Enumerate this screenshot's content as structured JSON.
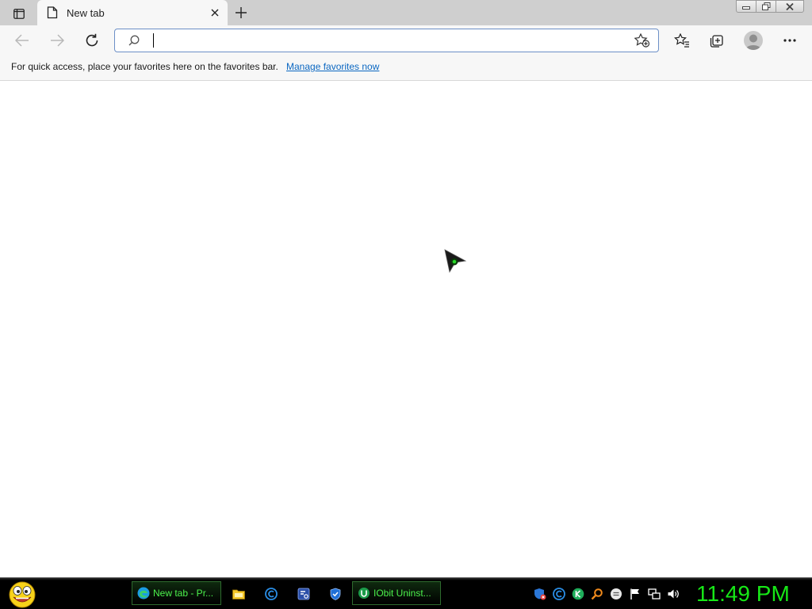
{
  "browser": {
    "tab": {
      "title": "New tab"
    },
    "address": {
      "value": "",
      "placeholder": ""
    },
    "favorites_bar": {
      "message": "For quick access, place your favorites here on the favorites bar.",
      "link": "Manage favorites now"
    }
  },
  "taskbar": {
    "tasks": [
      {
        "label": "New tab - Pr...",
        "icon": "edge-icon"
      },
      {
        "label": "IObit Uninst...",
        "icon": "iobit-uninstaller-icon"
      }
    ],
    "quick_launch": [
      "folder-icon",
      "ccleaner-icon",
      "settings-app-icon",
      "shield-app-icon"
    ],
    "tray": [
      "security-shield-icon",
      "ccleaner-tray-icon",
      "k-app-icon",
      "search-tray-icon",
      "chat-icon",
      "flag-icon",
      "network-icon",
      "volume-icon"
    ],
    "clock": "11:49 PM"
  },
  "colors": {
    "accent_green": "#17e817",
    "link_blue": "#0b67c2",
    "address_border": "#6c8fc7"
  }
}
